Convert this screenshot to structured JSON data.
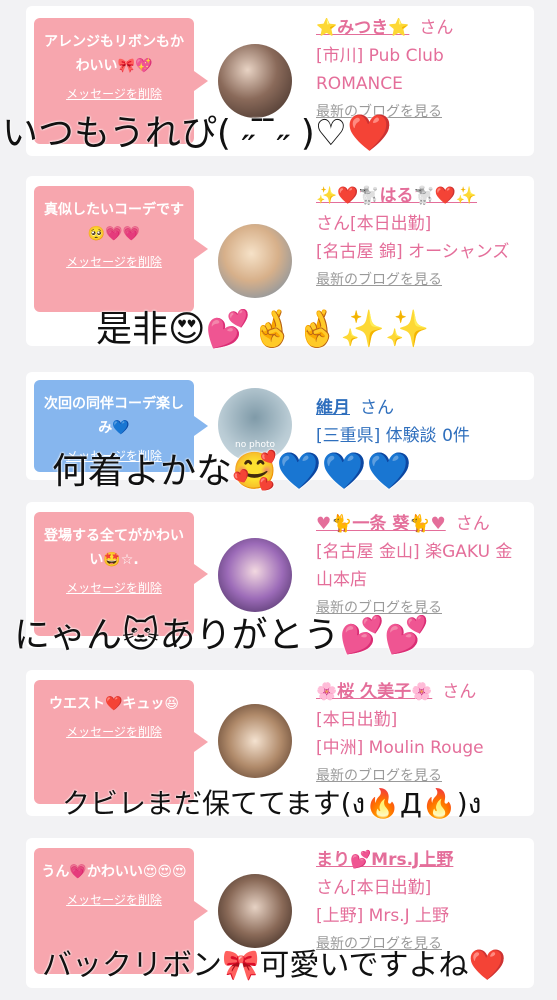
{
  "cards": [
    {
      "message": "アレンジもリボンもかわいい🎀💖",
      "delete_label": "メッセージを削除",
      "name": "⭐️みつき⭐️",
      "san": "さん",
      "lines": [
        "[市川] Pub Club ROMANCE"
      ],
      "blog_label": "最新のブログを見る"
    },
    {
      "message": "真似したいコーデです🥺💗💗",
      "delete_label": "メッセージを削除",
      "name": "✨❤️🐩はる🐩❤️✨",
      "san": "さん[本日出勤]",
      "lines": [
        "[名古屋 錦] オーシャンズ"
      ],
      "blog_label": "最新のブログを見る"
    },
    {
      "message": "次回の同伴コーデ楽しみ💙",
      "delete_label": "メッセージを削除",
      "name": "維月",
      "san": "さん",
      "lines": [
        "[三重県] 体験談 0件"
      ],
      "blog_label": "",
      "avatar_text": "no photo"
    },
    {
      "message": "登場する全てがかわいい🤩☆.",
      "delete_label": "メッセージを削除",
      "name": "♥🐈一条 葵🐈♥",
      "san": "さん",
      "lines": [
        "[名古屋 金山] 楽GAKU 金山本店"
      ],
      "blog_label": "最新のブログを見る"
    },
    {
      "message": "ウエスト❤️キュッ😆",
      "delete_label": "メッセージを削除",
      "name": "🌸桜 久美子🌸",
      "san": "さん",
      "lines": [
        "[本日出勤]",
        "[中洲] Moulin Rouge"
      ],
      "blog_label": "最新のブログを見る"
    },
    {
      "message": "うん💗かわいい😍😍😍",
      "delete_label": "メッセージを削除",
      "name": "まり💕Mrs.J上野",
      "san": "さん[本日出勤]",
      "lines": [
        "[上野] Mrs.J 上野"
      ],
      "blog_label": "最新のブログを見る"
    }
  ],
  "overlays": [
    "いつもうれぴ( ˶ ̄ ̄˶ )♡❤️",
    "是非😍💕🤞🤞✨✨",
    "何着よかな🥰💙💙💙",
    "にゃん🐱ありがとう💕💕",
    "クビレまだ保ててます(ง🔥Д🔥)ง",
    "バックリボン🎀可愛いですよね❤️"
  ],
  "colors": {
    "bubble_pink": "#f7a6ae",
    "bubble_blue": "#86b6ee",
    "name_pink": "#e46e9a",
    "name_blue": "#2f6fbd",
    "background": "#f2f2f4"
  }
}
